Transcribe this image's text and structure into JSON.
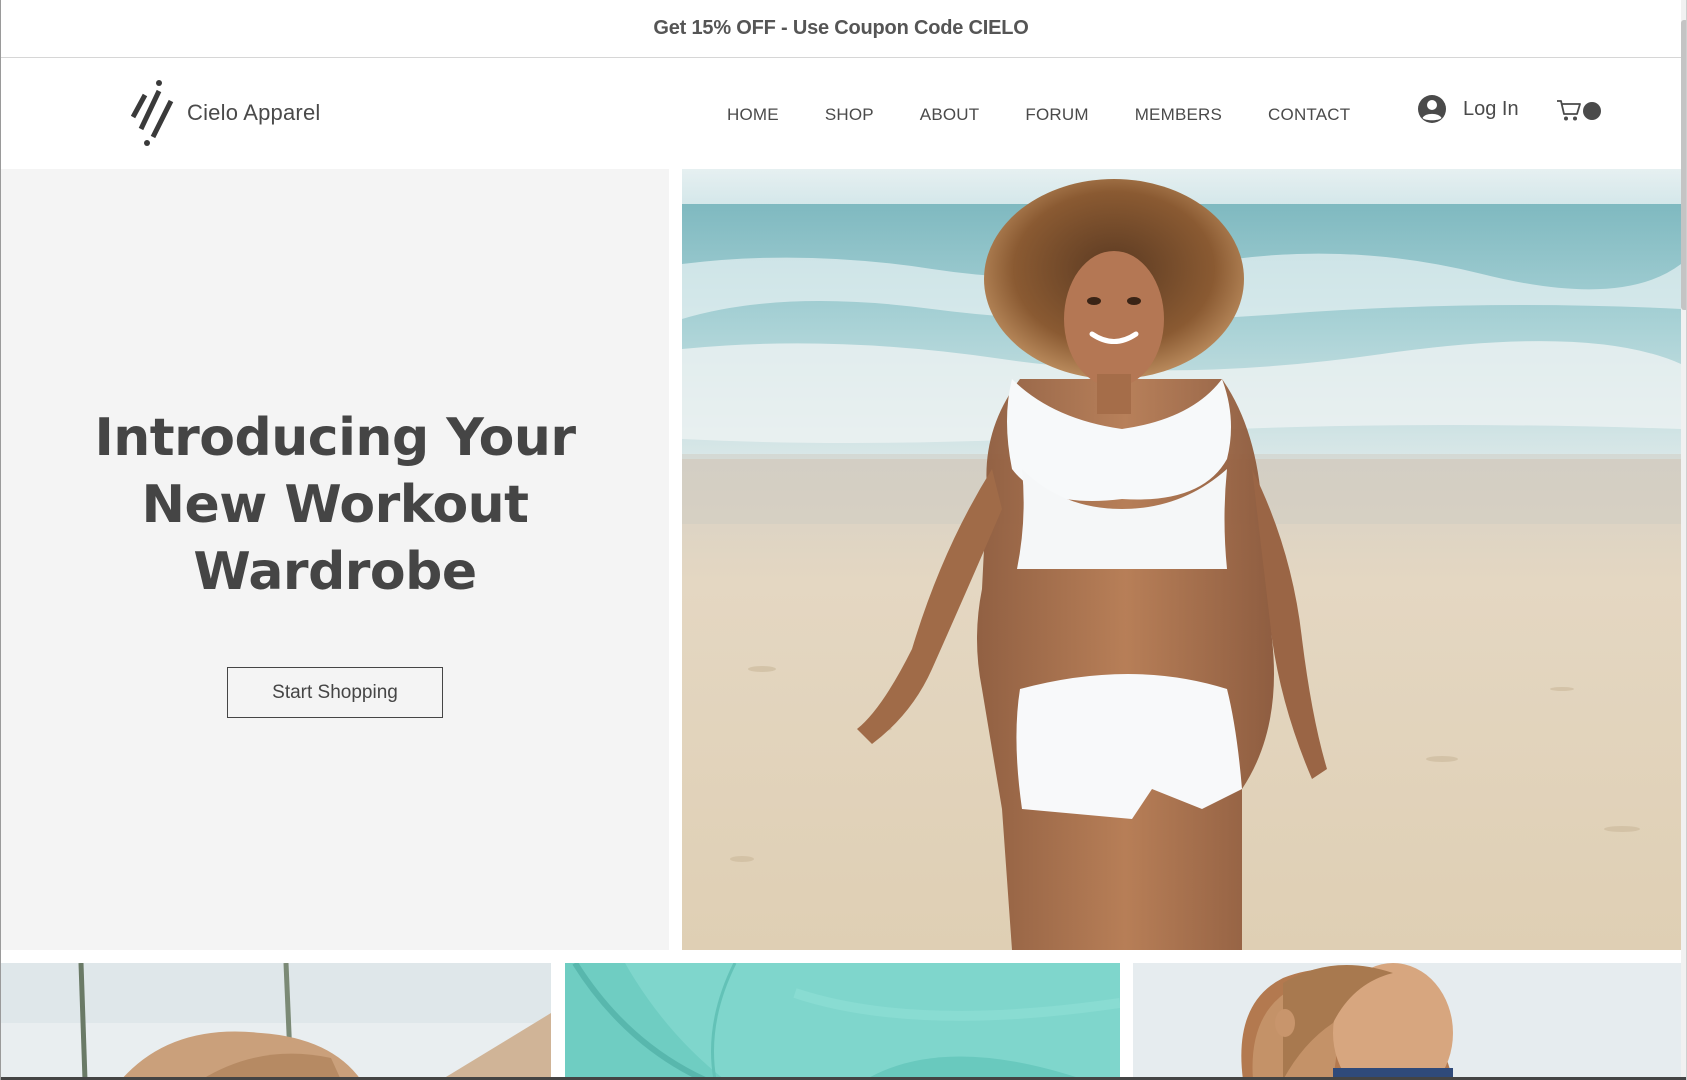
{
  "promo": {
    "text": "Get 15% OFF - Use Coupon Code CIELO"
  },
  "header": {
    "brand_name": "Cielo Apparel",
    "logo_icon": "cielo-slash-logo",
    "nav": [
      {
        "label": "HOME"
      },
      {
        "label": "SHOP"
      },
      {
        "label": "ABOUT"
      },
      {
        "label": "FORUM"
      },
      {
        "label": "MEMBERS"
      },
      {
        "label": "CONTACT"
      }
    ],
    "login_label": "Log In",
    "login_icon": "user-avatar-icon",
    "cart_icon": "shopping-cart-icon"
  },
  "hero": {
    "title_lines": [
      "Introducing Your",
      "New Workout",
      "Wardrobe"
    ],
    "cta_label": "Start Shopping",
    "image_subject": "woman in white sports bra and shorts walking on beach"
  },
  "tiles": [
    {
      "image_subject": "woman outdoors near palm trees"
    },
    {
      "image_subject": "turquoise athletic top close-up"
    },
    {
      "image_subject": "woman with hair tied back in profile"
    }
  ],
  "colors": {
    "text": "#4a4a4a",
    "hero_panel_bg": "#f4f4f4",
    "accent_dark": "#454545"
  }
}
